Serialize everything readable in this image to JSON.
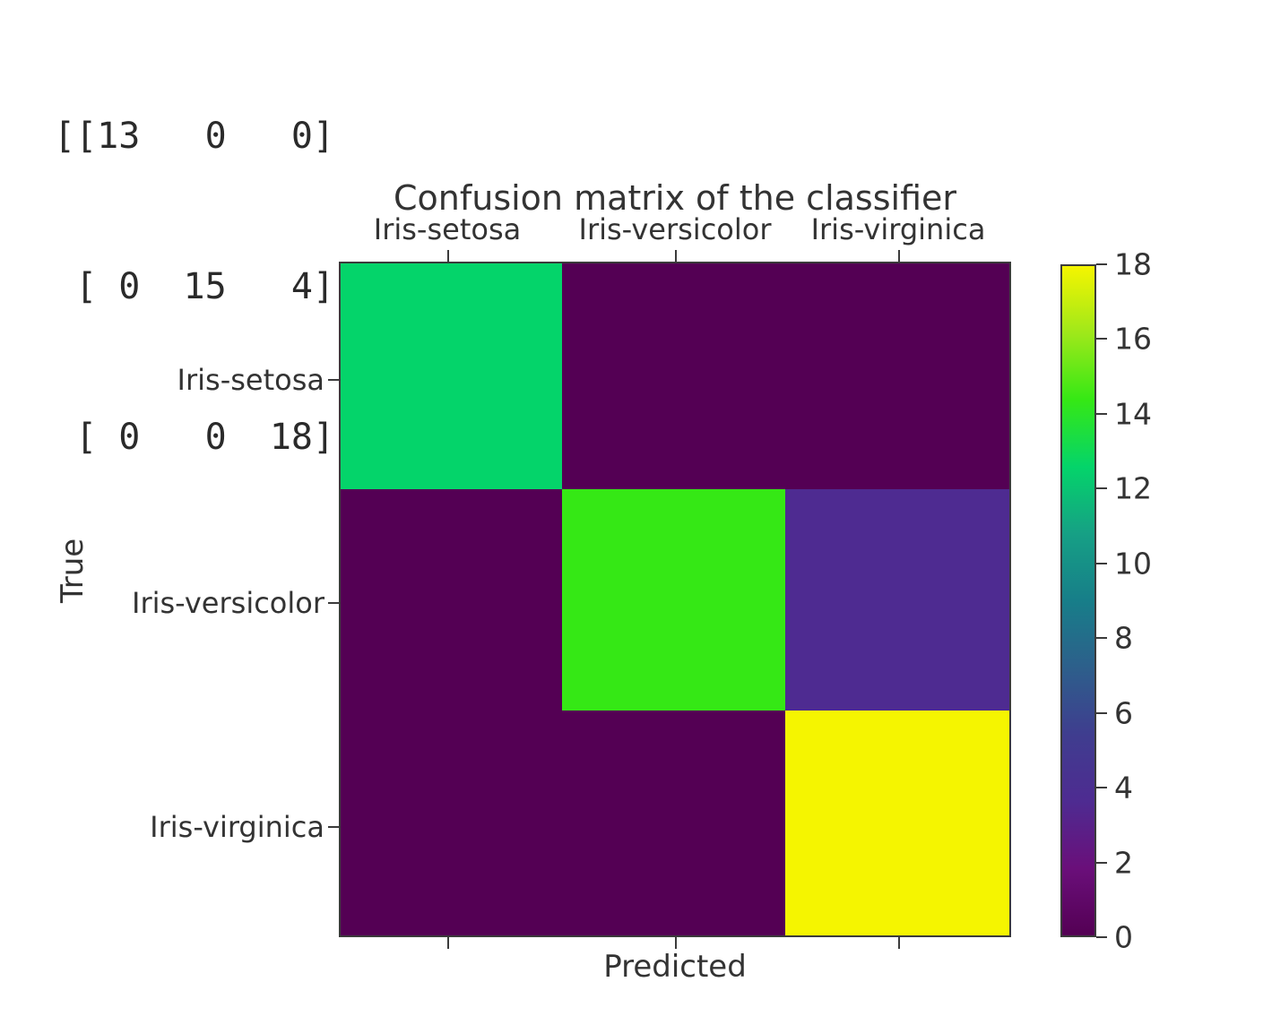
{
  "console": {
    "lines": [
      "[[13   0   0]",
      " [ 0  15   4]",
      " [ 0   0  18]]"
    ]
  },
  "chart_data": {
    "type": "heatmap",
    "title": "Confusion matrix of the classifier",
    "xlabel": "Predicted",
    "ylabel": "True",
    "categories_x": [
      "Iris-setosa",
      "Iris-versicolor",
      "Iris-virginica"
    ],
    "categories_y": [
      "Iris-setosa",
      "Iris-versicolor",
      "Iris-virginica"
    ],
    "matrix": [
      [
        13,
        0,
        0
      ],
      [
        0,
        15,
        4
      ],
      [
        0,
        0,
        18
      ]
    ],
    "cell_colors": [
      [
        "#04d46a",
        "#540054",
        "#540054"
      ],
      [
        "#540054",
        "#35e815",
        "#4e2b91"
      ],
      [
        "#540054",
        "#540054",
        "#f5f500"
      ]
    ],
    "colorbar": {
      "vmin": 0,
      "vmax": 18,
      "ticks": [
        18,
        16,
        14,
        12,
        10,
        8,
        6,
        4,
        2,
        0
      ],
      "position": "right",
      "colormap": "viridis-like",
      "stops": [
        "#f5f500",
        "#9fe81a",
        "#35e815",
        "#04d46a",
        "#16a085",
        "#177e89",
        "#2d5f8b",
        "#3f3d8f",
        "#4e2b91",
        "#6a0f7a",
        "#540054"
      ]
    },
    "grid": false,
    "legend": "colorbar"
  }
}
